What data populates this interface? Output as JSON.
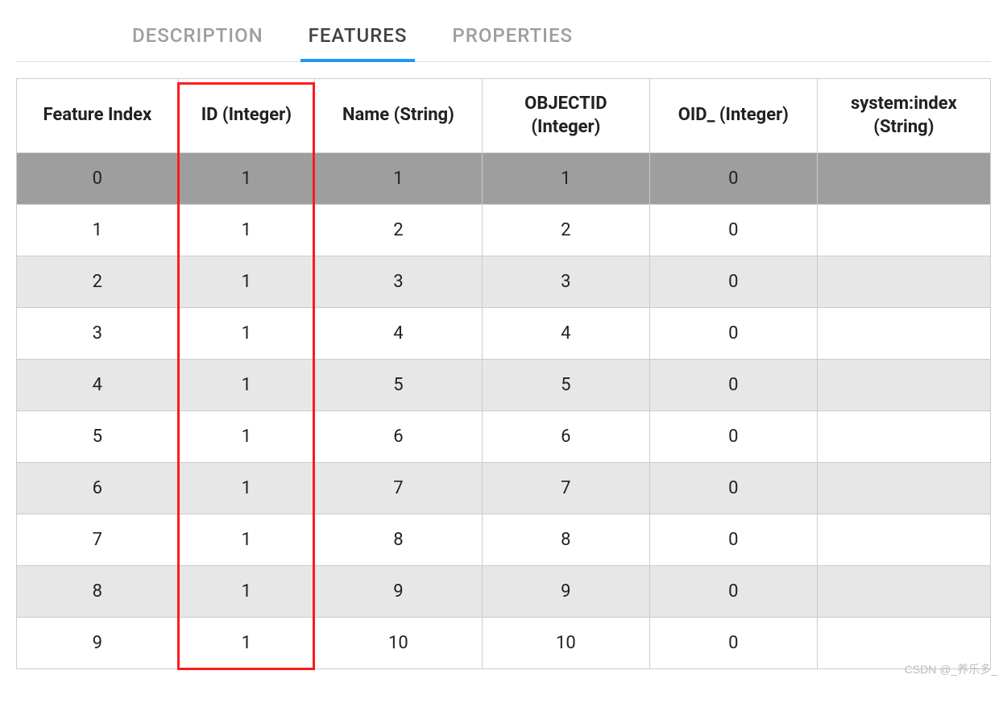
{
  "tabs": {
    "description": "DESCRIPTION",
    "features": "FEATURES",
    "properties": "PROPERTIES",
    "active": "features"
  },
  "columns": [
    "Feature Index",
    "ID (Integer)",
    "Name (String)",
    "OBJECTID (Integer)",
    "OID_ (Integer)",
    "system:index (String)"
  ],
  "rows": [
    {
      "feature_index": "0",
      "id": "1",
      "name": "1",
      "objectid": "1",
      "oid": "0",
      "sys_index": ""
    },
    {
      "feature_index": "1",
      "id": "1",
      "name": "2",
      "objectid": "2",
      "oid": "0",
      "sys_index": ""
    },
    {
      "feature_index": "2",
      "id": "1",
      "name": "3",
      "objectid": "3",
      "oid": "0",
      "sys_index": ""
    },
    {
      "feature_index": "3",
      "id": "1",
      "name": "4",
      "objectid": "4",
      "oid": "0",
      "sys_index": ""
    },
    {
      "feature_index": "4",
      "id": "1",
      "name": "5",
      "objectid": "5",
      "oid": "0",
      "sys_index": ""
    },
    {
      "feature_index": "5",
      "id": "1",
      "name": "6",
      "objectid": "6",
      "oid": "0",
      "sys_index": ""
    },
    {
      "feature_index": "6",
      "id": "1",
      "name": "7",
      "objectid": "7",
      "oid": "0",
      "sys_index": ""
    },
    {
      "feature_index": "7",
      "id": "1",
      "name": "8",
      "objectid": "8",
      "oid": "0",
      "sys_index": ""
    },
    {
      "feature_index": "8",
      "id": "1",
      "name": "9",
      "objectid": "9",
      "oid": "0",
      "sys_index": ""
    },
    {
      "feature_index": "9",
      "id": "1",
      "name": "10",
      "objectid": "10",
      "oid": "0",
      "sys_index": ""
    }
  ],
  "highlight": {
    "column_index": 1
  },
  "watermark": "CSDN @_养乐多_"
}
